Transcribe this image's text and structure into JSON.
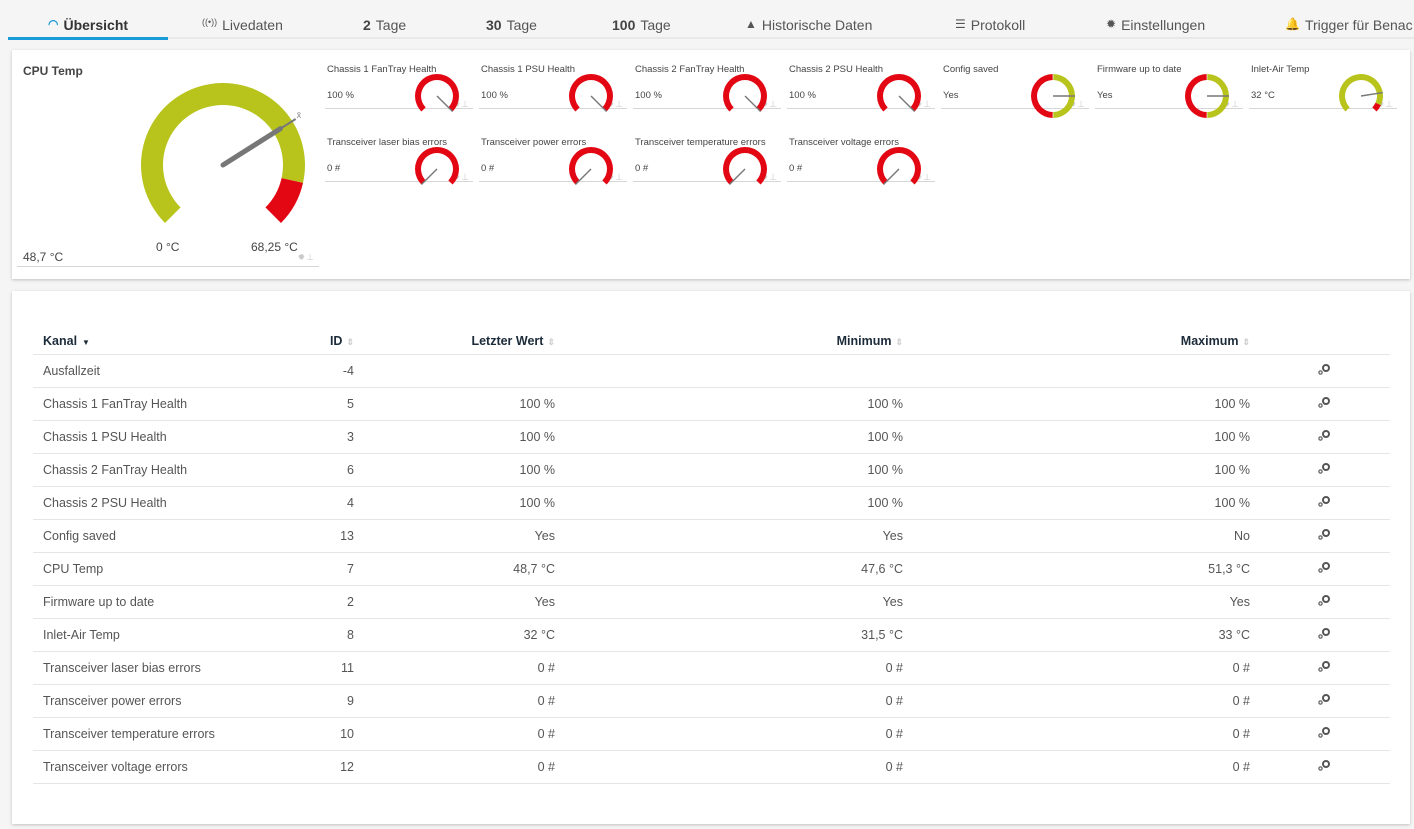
{
  "tabs": [
    {
      "icon": "gauge-icon",
      "glyph": "◠",
      "bold": "",
      "label": "Übersicht",
      "active": true
    },
    {
      "icon": "broadcast-icon",
      "glyph": "((•))",
      "bold": "",
      "label": "Livedaten"
    },
    {
      "icon": "",
      "glyph": "",
      "bold": "2",
      "label": "Tage"
    },
    {
      "icon": "",
      "glyph": "",
      "bold": "30",
      "label": "Tage"
    },
    {
      "icon": "",
      "glyph": "",
      "bold": "100",
      "label": "Tage"
    },
    {
      "icon": "area-chart-icon",
      "glyph": "▲",
      "bold": "",
      "label": "Historische Daten"
    },
    {
      "icon": "list-icon",
      "glyph": "☰",
      "bold": "",
      "label": "Protokoll"
    },
    {
      "icon": "gear-icon",
      "glyph": "✹",
      "bold": "",
      "label": "Einstellungen"
    },
    {
      "icon": "bell-icon",
      "glyph": "🔔",
      "bold": "",
      "label": "Trigger für Benac"
    }
  ],
  "big_gauge": {
    "title": "CPU Temp",
    "value_text": "48,7 °C",
    "min_label": "0 °C",
    "max_label": "68,25 °C",
    "mean_marker": "x̄",
    "value": 48.7,
    "min": 0,
    "max": 68.25,
    "red_zone_from_fraction": 0.88,
    "colors": {
      "ok": "#b8c41c",
      "alarm": "#e30613",
      "needle": "#777777"
    }
  },
  "small_gauges": [
    {
      "title": "Chassis 1 FanTray Health",
      "value_text": "100 %",
      "type": "red",
      "needle_fraction": 1.0
    },
    {
      "title": "Chassis 1 PSU Health",
      "value_text": "100 %",
      "type": "red",
      "needle_fraction": 1.0
    },
    {
      "title": "Chassis 2 FanTray Health",
      "value_text": "100 %",
      "type": "red",
      "needle_fraction": 1.0
    },
    {
      "title": "Chassis 2 PSU Health",
      "value_text": "100 %",
      "type": "red",
      "needle_fraction": 1.0
    },
    {
      "title": "Config saved",
      "value_text": "Yes",
      "type": "split",
      "needle_fraction": 0.5
    },
    {
      "title": "Firmware up to date",
      "value_text": "Yes",
      "type": "split",
      "needle_fraction": 0.5
    },
    {
      "title": "Inlet-Air Temp",
      "value_text": "32 °C",
      "type": "green",
      "needle_fraction": 0.8
    },
    {
      "title": "Transceiver laser bias errors",
      "value_text": "0 #",
      "type": "red",
      "needle_fraction": 0.0
    },
    {
      "title": "Transceiver power errors",
      "value_text": "0 #",
      "type": "red",
      "needle_fraction": 0.0
    },
    {
      "title": "Transceiver temperature errors",
      "value_text": "0 #",
      "type": "red",
      "needle_fraction": 0.0
    },
    {
      "title": "Transceiver voltage errors",
      "value_text": "0 #",
      "type": "red",
      "needle_fraction": 0.0
    }
  ],
  "table": {
    "headers": {
      "kanal": "Kanal",
      "id": "ID",
      "last": "Letzter Wert",
      "min": "Minimum",
      "max": "Maximum"
    },
    "sort_active_glyph": "▼",
    "sort_glyph": "⇕",
    "rows": [
      {
        "kanal": "Ausfallzeit",
        "id": "-4",
        "last": "",
        "min": "",
        "max": ""
      },
      {
        "kanal": "Chassis 1 FanTray Health",
        "id": "5",
        "last": "100 %",
        "min": "100 %",
        "max": "100 %"
      },
      {
        "kanal": "Chassis 1 PSU Health",
        "id": "3",
        "last": "100 %",
        "min": "100 %",
        "max": "100 %"
      },
      {
        "kanal": "Chassis 2 FanTray Health",
        "id": "6",
        "last": "100 %",
        "min": "100 %",
        "max": "100 %"
      },
      {
        "kanal": "Chassis 2 PSU Health",
        "id": "4",
        "last": "100 %",
        "min": "100 %",
        "max": "100 %"
      },
      {
        "kanal": "Config saved",
        "id": "13",
        "last": "Yes",
        "min": "Yes",
        "max": "No"
      },
      {
        "kanal": "CPU Temp",
        "id": "7",
        "last": "48,7 °C",
        "min": "47,6 °C",
        "max": "51,3 °C"
      },
      {
        "kanal": "Firmware up to date",
        "id": "2",
        "last": "Yes",
        "min": "Yes",
        "max": "Yes"
      },
      {
        "kanal": "Inlet-Air Temp",
        "id": "8",
        "last": "32 °C",
        "min": "31,5 °C",
        "max": "33 °C"
      },
      {
        "kanal": "Transceiver laser bias errors",
        "id": "11",
        "last": "0 #",
        "min": "0 #",
        "max": "0 #"
      },
      {
        "kanal": "Transceiver power errors",
        "id": "9",
        "last": "0 #",
        "min": "0 #",
        "max": "0 #"
      },
      {
        "kanal": "Transceiver temperature errors",
        "id": "10",
        "last": "0 #",
        "min": "0 #",
        "max": "0 #"
      },
      {
        "kanal": "Transceiver voltage errors",
        "id": "12",
        "last": "0 #",
        "min": "0 #",
        "max": "0 #"
      }
    ]
  }
}
